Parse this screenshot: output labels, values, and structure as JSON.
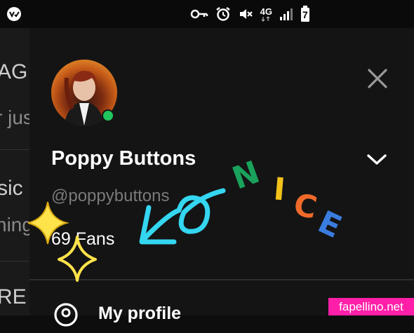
{
  "status_bar": {
    "network_label": "4G",
    "battery_label": "7",
    "icons": [
      "notification-app-icon",
      "key-icon",
      "alarm-icon",
      "mute-icon",
      "network-icon",
      "signal-icon",
      "battery-icon"
    ]
  },
  "background_list": {
    "item1_title": "AG",
    "item1_sub": "r jus",
    "item2_title": "sic",
    "item2_sub": "ning",
    "item3_title": "RE"
  },
  "profile": {
    "name": "Poppy Buttons",
    "handle": "@poppybuttons",
    "fans": "69 Fans",
    "online": true
  },
  "menu": {
    "profile_label": "My profile"
  },
  "sticker": {
    "text": "NICE",
    "letters": [
      "N",
      "I",
      "C",
      "E"
    ],
    "colors": {
      "N": "#1aa25c",
      "I": "#f2c21a",
      "C": "#f06a2a",
      "E": "#3a7de0"
    },
    "arrow_color": "#34d6f0",
    "sparkle_color": "#ffe34a"
  },
  "watermark": {
    "text": "fapellino.net"
  },
  "colors": {
    "online": "#22c55e",
    "drawer_bg": "#141414",
    "text_secondary": "#7a7a7a"
  }
}
